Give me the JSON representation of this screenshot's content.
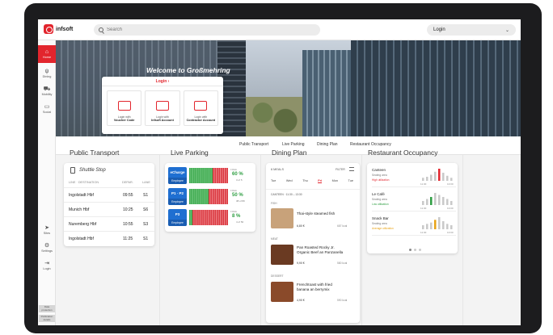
{
  "app": {
    "name": "infsoft",
    "search_placeholder": "Search",
    "login_select": "Login"
  },
  "sidebar": {
    "items": [
      {
        "label": "Home",
        "icon": "home-icon"
      },
      {
        "label": "Dining",
        "icon": "fork-knife-icon"
      },
      {
        "label": "Mobility",
        "icon": "car-icon"
      },
      {
        "label": "Social",
        "icon": "chat-icon"
      },
      {
        "label": "Sites",
        "icon": "navigation-arrow-icon"
      },
      {
        "label": "Settings",
        "icon": "gear-icon"
      },
      {
        "label": "Login",
        "icon": "login-icon"
      }
    ],
    "footer": [
      "Data protection",
      "Publication details"
    ]
  },
  "hero": {
    "welcome": "Welcome to Großmehring"
  },
  "login_card": {
    "title": "Login",
    "options": [
      {
        "line1": "Login with",
        "line2": "Voucher Code"
      },
      {
        "line1": "Login with",
        "line2": "Infsoft Account"
      },
      {
        "line1": "Login with",
        "line2": "Contractor Account"
      }
    ]
  },
  "tabs": [
    "Public Transport",
    "Live Parking",
    "Dining Plan",
    "Restaurant Occupancy"
  ],
  "sections": {
    "public_transport": "Public Transport",
    "live_parking": "Live Parking",
    "dining_plan": "Dining Plan",
    "restaurant_occupancy": "Restaurant Occupancy"
  },
  "shuttle": {
    "title": "Shuttle Stop",
    "headers": {
      "line": "LINE · DESTINATION",
      "depart": "DEPAR.",
      "lane": "LANE"
    },
    "rows": [
      {
        "dest": "Ingolstadt Hbf",
        "time": "09:55",
        "lane": "S1"
      },
      {
        "dest": "Munich Hbf",
        "time": "10:25",
        "lane": "S6"
      },
      {
        "dest": "Nuremberg Hbf",
        "time": "10:55",
        "lane": "S3"
      },
      {
        "dest": "Ingolstadt Hbf",
        "time": "11:25",
        "lane": "S1"
      }
    ]
  },
  "parking": [
    {
      "name": "eCharge",
      "sub": "Employee",
      "pct": "60 %",
      "count": "3 of 5",
      "free_label": "FREE",
      "occupancy": 0.4
    },
    {
      "name": "P1 · P2",
      "sub": "Employee",
      "pct": "50 %",
      "count": "38 of 80",
      "free_label": "FREE",
      "occupancy": 0.5
    },
    {
      "name": "P3",
      "sub": "Employee",
      "pct": "8 %",
      "count": "4 of 50",
      "free_label": "FREE",
      "occupancy": 0.92
    }
  ],
  "dining": {
    "top": "6 MEALS",
    "filter": "FILTER",
    "days": [
      "Tue",
      "Wed",
      "Thu",
      "Fri",
      "Mon",
      "Tue"
    ],
    "active_day": 3,
    "canteen": "CANTEEN · 11:30 – 13:30",
    "meals": [
      {
        "category": "FISH",
        "name": "Thai-style steamed fish",
        "price": "6,80 €",
        "kcal": "687 kcal",
        "color": "#c8a27a"
      },
      {
        "category": "MEAT",
        "name": "Pan Roasted Rocky Jr. Organic Beef an Panzanella",
        "price": "9,90 €",
        "kcal": "580 kcal",
        "color": "#6a3a22"
      },
      {
        "category": "DESSERT",
        "name": "Frenchtoast with fried banana an berrymix",
        "price": "4,90 €",
        "kcal": "590 kcal",
        "color": "#8a4a2a"
      }
    ]
  },
  "occupancy": [
    {
      "name": "Canteen",
      "area": "Seating area",
      "status": "High utilization",
      "status_color": "#e2252d",
      "t1": "11:30",
      "t2": "13:00",
      "bars": [
        3,
        4,
        6,
        9,
        12,
        8,
        5,
        3
      ],
      "highlight": 4
    },
    {
      "name": "Le Café",
      "area": "Seating area",
      "status": "Low utilization",
      "status_color": "#2e9e42",
      "t1": "11:30",
      "t2": "13:00",
      "bars": [
        2,
        3,
        4,
        6,
        5,
        4,
        3,
        2
      ],
      "highlight": 2
    },
    {
      "name": "Snack Bar",
      "area": "Seating area",
      "status": "Average utilization",
      "status_color": "#e8a317",
      "t1": "11:30",
      "t2": "13:00",
      "bars": [
        3,
        4,
        5,
        7,
        9,
        6,
        4,
        3
      ],
      "highlight": 3
    }
  ],
  "colors": {
    "brand": "#e2252d",
    "parking_blue": "#1f6fd1",
    "free_green": "#2e9e42"
  }
}
